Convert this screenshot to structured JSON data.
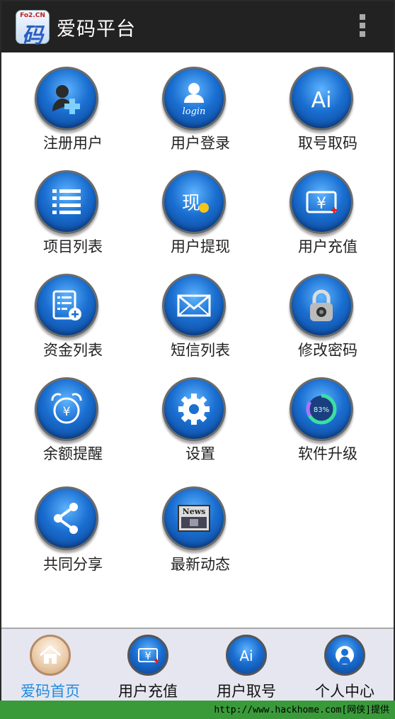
{
  "app": {
    "title": "爱码平台",
    "logo_small": "Fo2.CN",
    "logo_big": "码"
  },
  "menu": [
    {
      "label": "注册用户",
      "icon": "add-user-icon"
    },
    {
      "label": "用户登录",
      "icon": "login-icon",
      "icon_text": "login"
    },
    {
      "label": "取号取码",
      "icon": "ai-icon",
      "icon_text": "Ai"
    },
    {
      "label": "项目列表",
      "icon": "list-icon"
    },
    {
      "label": "用户提现",
      "icon": "withdraw-icon",
      "icon_text": "现"
    },
    {
      "label": "用户充值",
      "icon": "recharge-icon",
      "icon_text": "¥"
    },
    {
      "label": "资金列表",
      "icon": "fund-list-icon"
    },
    {
      "label": "短信列表",
      "icon": "envelope-icon"
    },
    {
      "label": "修改密码",
      "icon": "lock-icon"
    },
    {
      "label": "余额提醒",
      "icon": "alarm-clock-icon",
      "icon_text": "¥"
    },
    {
      "label": "设置",
      "icon": "gear-icon"
    },
    {
      "label": "软件升级",
      "icon": "upgrade-progress-icon",
      "icon_text": "83%"
    },
    {
      "label": "共同分享",
      "icon": "share-icon"
    },
    {
      "label": "最新动态",
      "icon": "news-icon",
      "icon_text": "News"
    }
  ],
  "tabs": [
    {
      "label": "爱码首页",
      "icon": "home-icon",
      "active": true
    },
    {
      "label": "用户充值",
      "icon": "recharge-icon",
      "icon_text": "¥"
    },
    {
      "label": "用户取号",
      "icon": "ai-icon",
      "icon_text": "Ai"
    },
    {
      "label": "个人中心",
      "icon": "user-center-icon"
    }
  ],
  "footer": "http://www.hackhome.com[网侠]提供",
  "colors": {
    "titlebar": "#222222",
    "icon_blue": "#1a6fd1",
    "active_tab": "#1f8be0",
    "footer_bg": "#3a9a3a"
  }
}
